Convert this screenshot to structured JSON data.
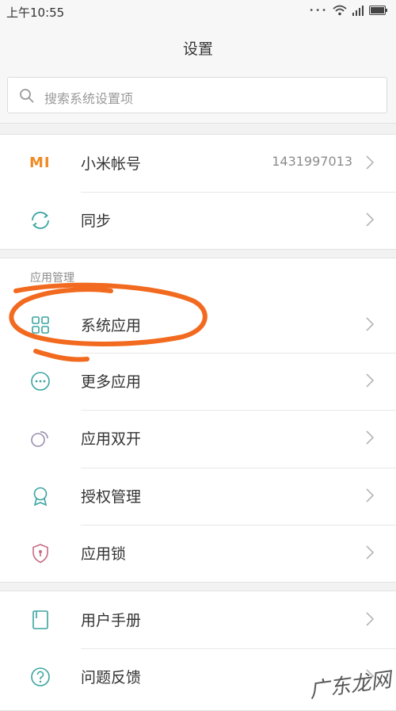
{
  "status_bar": {
    "time": "上午10:55"
  },
  "header": {
    "title": "设置"
  },
  "search": {
    "placeholder": "搜索系统设置项"
  },
  "account_group": {
    "items": [
      {
        "label": "小米帐号",
        "value": "1431997013",
        "icon": "mi-logo-icon"
      },
      {
        "label": "同步",
        "icon": "sync-icon"
      }
    ]
  },
  "app_management": {
    "section_label": "应用管理",
    "items": [
      {
        "label": "系统应用",
        "icon": "grid-icon"
      },
      {
        "label": "更多应用",
        "icon": "more-dots-icon"
      },
      {
        "label": "应用双开",
        "icon": "dual-circle-icon"
      },
      {
        "label": "授权管理",
        "icon": "badge-icon"
      },
      {
        "label": "应用锁",
        "icon": "shield-lock-icon"
      }
    ]
  },
  "help_group": {
    "items": [
      {
        "label": "用户手册",
        "icon": "book-icon"
      },
      {
        "label": "问题反馈",
        "icon": "question-icon"
      }
    ]
  },
  "logo_text": "MI",
  "watermark": "广东龙网",
  "colors": {
    "accent_teal": "#3aa4a0",
    "mi_orange": "#f08a24",
    "annotation": "#f26a1f"
  }
}
